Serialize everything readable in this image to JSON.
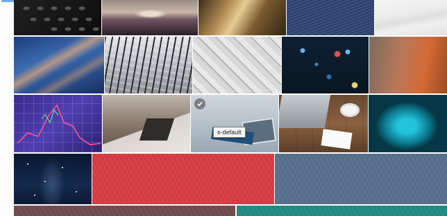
{
  "gallery": {
    "tooltip_text": "x-default",
    "selected_index": 12,
    "thumbnails": [
      {
        "label": "keyboard-keys-photo"
      },
      {
        "label": "sunset-over-sea-photo"
      },
      {
        "label": "golden-blur-photo"
      },
      {
        "label": "blue-fabric-photo"
      },
      {
        "label": "white-marble-photo"
      },
      {
        "label": "blue-water-photo"
      },
      {
        "label": "mixing-console-photo"
      },
      {
        "label": "white-3d-pattern-photo"
      },
      {
        "label": "city-bokeh-photo"
      },
      {
        "label": "orange-blur-photo"
      },
      {
        "label": "stock-chart-photo"
      },
      {
        "label": "office-desk-laptop-photo"
      },
      {
        "label": "tablet-notebook-desk-photo"
      },
      {
        "label": "laptop-coffee-photo"
      },
      {
        "label": "cyan-bokeh-photo"
      },
      {
        "label": "starry-sky-photo"
      },
      {
        "label": "red-chevron-pattern"
      },
      {
        "label": "slate-blue-chevron-pattern"
      },
      {
        "label": "brown-chevron-pattern"
      },
      {
        "label": "teal-chevron-pattern"
      }
    ]
  }
}
